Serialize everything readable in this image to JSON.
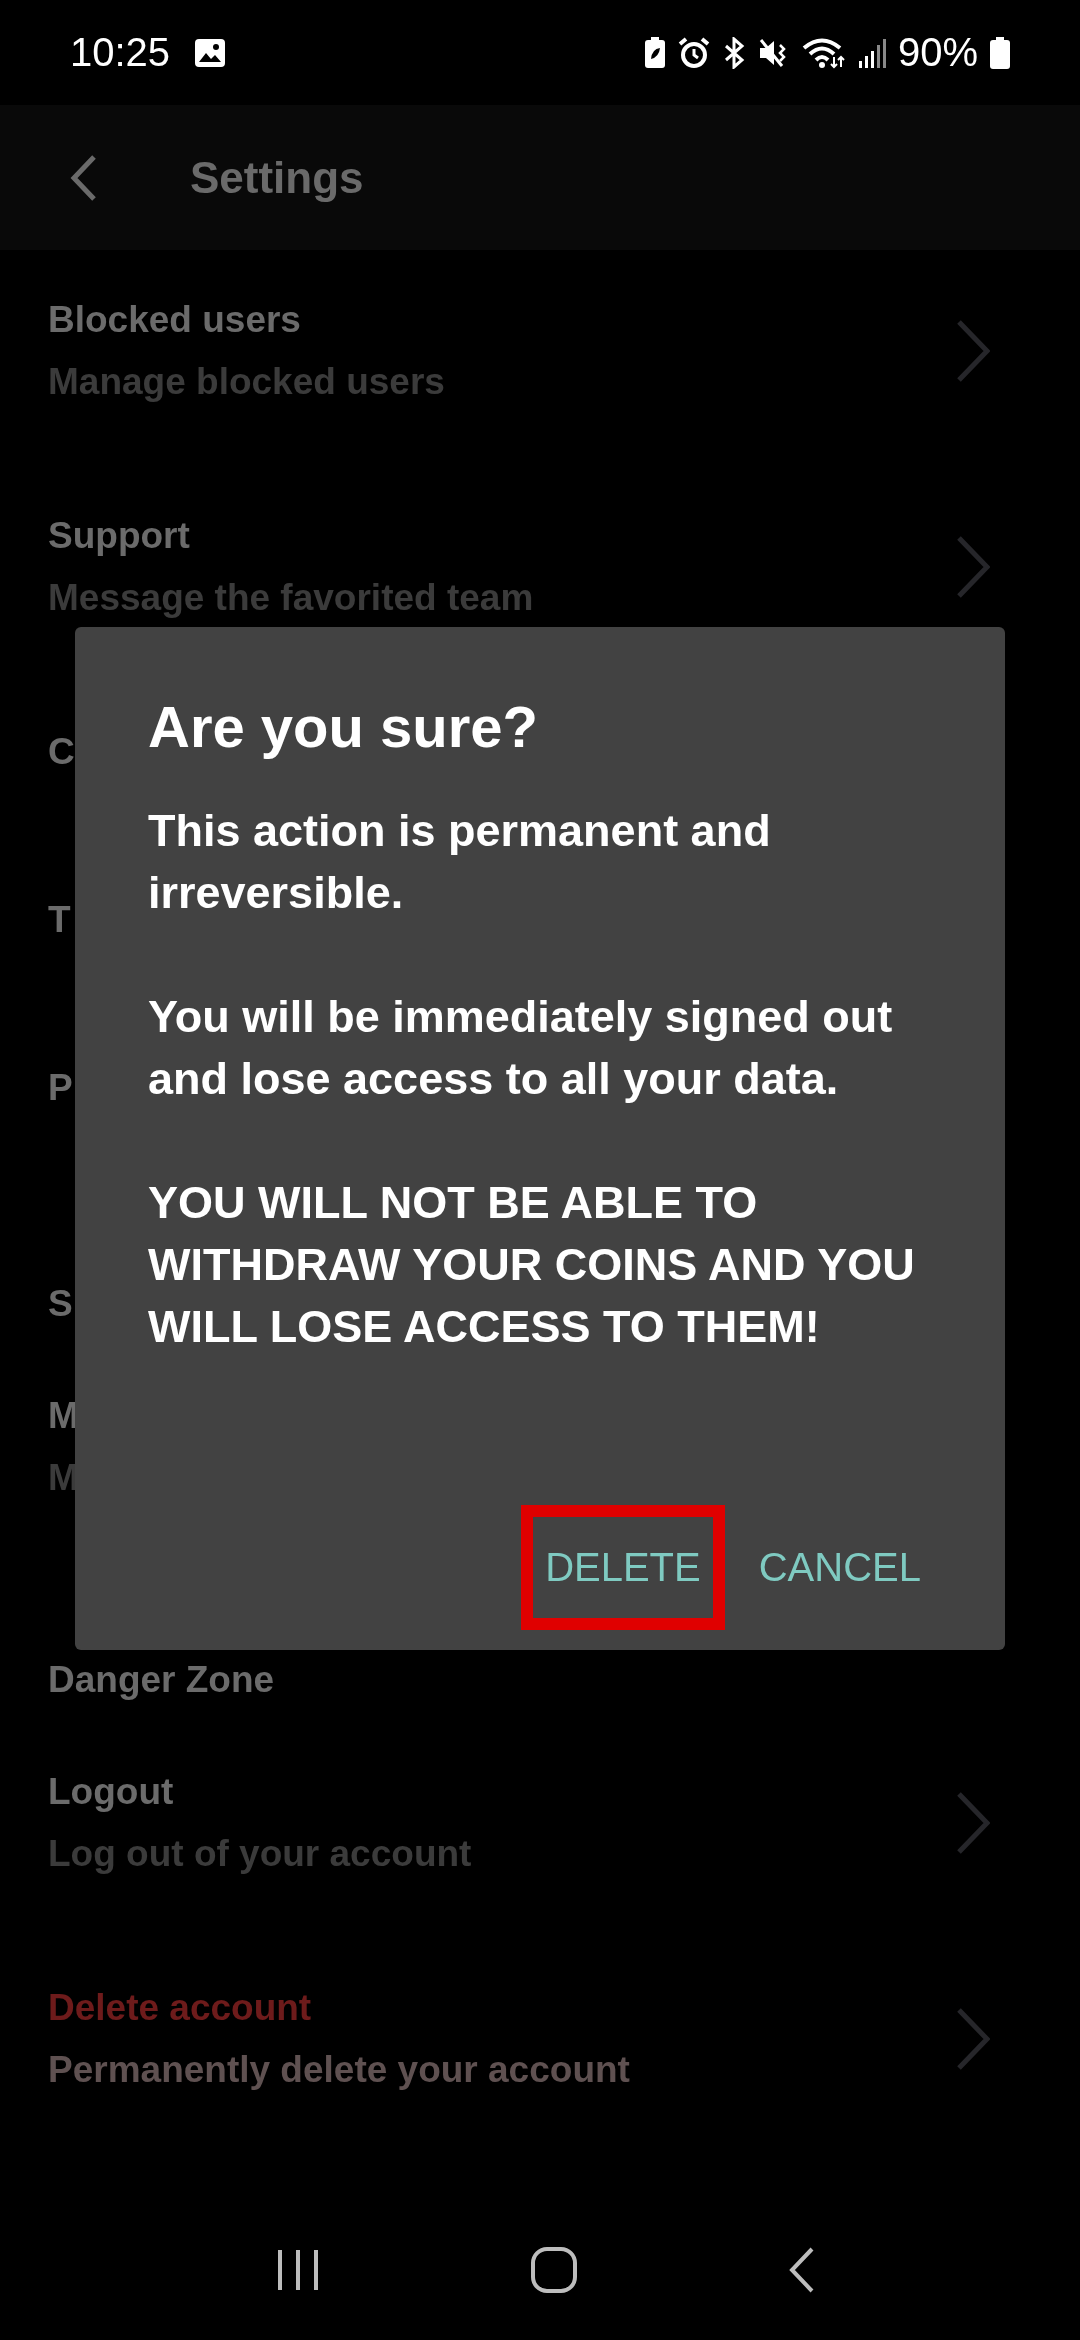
{
  "status_bar": {
    "time": "10:25",
    "battery": "90%"
  },
  "app_bar": {
    "title": "Settings"
  },
  "settings": [
    {
      "kind": "row",
      "title": "Blocked users",
      "subtitle": "Manage blocked users",
      "chevron": true
    },
    {
      "kind": "row",
      "title": "Support",
      "subtitle": "Message the favorited team",
      "chevron": true
    },
    {
      "kind": "row",
      "title": "C"
    },
    {
      "kind": "row",
      "title": "T"
    },
    {
      "kind": "row",
      "title": "P"
    },
    {
      "kind": "header",
      "title": "S"
    },
    {
      "kind": "row",
      "title": "M",
      "subtitle": "M"
    },
    {
      "kind": "header",
      "title": "Danger Zone"
    },
    {
      "kind": "row",
      "title": "Logout",
      "subtitle": "Log out of your account",
      "chevron": true
    },
    {
      "kind": "row",
      "title": "Delete account",
      "subtitle": "Permanently delete your account",
      "chevron": true,
      "danger": true
    }
  ],
  "dialog": {
    "title": "Are you sure?",
    "paragraphs": [
      "This action is permanent and irreversible.",
      "You will be immediately signed out and lose access to all your data.",
      "YOU WILL NOT BE ABLE TO WITHDRAW YOUR COINS AND YOU WILL LOSE ACCESS TO THEM!"
    ],
    "buttons": [
      {
        "label": "DELETE",
        "highlighted": true
      },
      {
        "label": "CANCEL",
        "highlighted": false
      }
    ]
  }
}
